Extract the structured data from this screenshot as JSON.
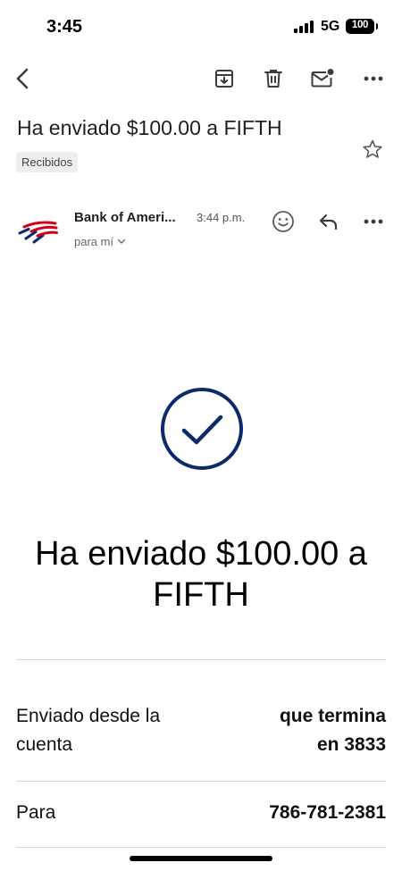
{
  "status_bar": {
    "time": "3:45",
    "network": "5G",
    "battery": "100"
  },
  "toolbar": {
    "back_icon": "chevron-left-icon",
    "archive_icon": "archive-icon",
    "delete_icon": "trash-icon",
    "mark_unread_icon": "mail-unread-icon",
    "more_icon": "more-horizontal-icon"
  },
  "email": {
    "subject": "Ha enviado $100.00 a FIFTH",
    "label": "Recibidos",
    "sender": "Bank of Ameri...",
    "time": "3:44 p.m.",
    "recipient": "para mí"
  },
  "body": {
    "headline_line1": "Ha enviado $100.00 a",
    "headline_line2": "FIFTH",
    "rows": [
      {
        "label_line1": "Enviado desde la",
        "label_line2": "cuenta",
        "value_line1": "que termina",
        "value_line2": "en 3833"
      },
      {
        "label_line1": "Para",
        "value_line1": "786-781-2381"
      }
    ]
  },
  "colors": {
    "brand_navy": "#0a2a6b",
    "brand_red": "#d4001a",
    "text": "#1f1f1f"
  }
}
